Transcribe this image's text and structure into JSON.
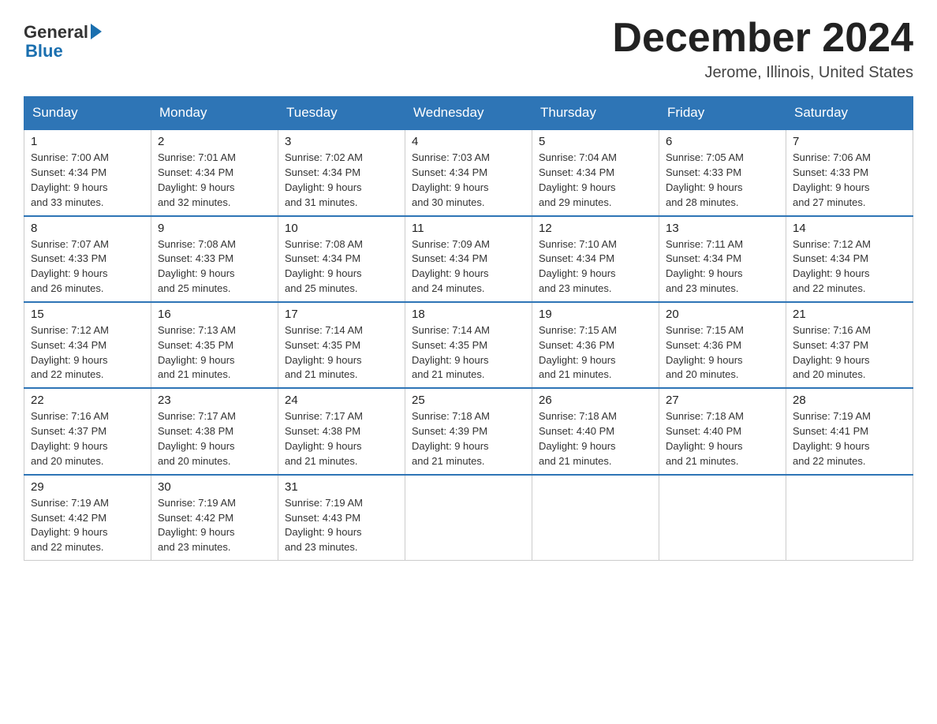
{
  "logo": {
    "text_general": "General",
    "text_blue": "Blue"
  },
  "title": "December 2024",
  "location": "Jerome, Illinois, United States",
  "weekdays": [
    "Sunday",
    "Monday",
    "Tuesday",
    "Wednesday",
    "Thursday",
    "Friday",
    "Saturday"
  ],
  "weeks": [
    [
      {
        "day": "1",
        "sunrise": "7:00 AM",
        "sunset": "4:34 PM",
        "daylight": "9 hours and 33 minutes."
      },
      {
        "day": "2",
        "sunrise": "7:01 AM",
        "sunset": "4:34 PM",
        "daylight": "9 hours and 32 minutes."
      },
      {
        "day": "3",
        "sunrise": "7:02 AM",
        "sunset": "4:34 PM",
        "daylight": "9 hours and 31 minutes."
      },
      {
        "day": "4",
        "sunrise": "7:03 AM",
        "sunset": "4:34 PM",
        "daylight": "9 hours and 30 minutes."
      },
      {
        "day": "5",
        "sunrise": "7:04 AM",
        "sunset": "4:34 PM",
        "daylight": "9 hours and 29 minutes."
      },
      {
        "day": "6",
        "sunrise": "7:05 AM",
        "sunset": "4:33 PM",
        "daylight": "9 hours and 28 minutes."
      },
      {
        "day": "7",
        "sunrise": "7:06 AM",
        "sunset": "4:33 PM",
        "daylight": "9 hours and 27 minutes."
      }
    ],
    [
      {
        "day": "8",
        "sunrise": "7:07 AM",
        "sunset": "4:33 PM",
        "daylight": "9 hours and 26 minutes."
      },
      {
        "day": "9",
        "sunrise": "7:08 AM",
        "sunset": "4:33 PM",
        "daylight": "9 hours and 25 minutes."
      },
      {
        "day": "10",
        "sunrise": "7:08 AM",
        "sunset": "4:34 PM",
        "daylight": "9 hours and 25 minutes."
      },
      {
        "day": "11",
        "sunrise": "7:09 AM",
        "sunset": "4:34 PM",
        "daylight": "9 hours and 24 minutes."
      },
      {
        "day": "12",
        "sunrise": "7:10 AM",
        "sunset": "4:34 PM",
        "daylight": "9 hours and 23 minutes."
      },
      {
        "day": "13",
        "sunrise": "7:11 AM",
        "sunset": "4:34 PM",
        "daylight": "9 hours and 23 minutes."
      },
      {
        "day": "14",
        "sunrise": "7:12 AM",
        "sunset": "4:34 PM",
        "daylight": "9 hours and 22 minutes."
      }
    ],
    [
      {
        "day": "15",
        "sunrise": "7:12 AM",
        "sunset": "4:34 PM",
        "daylight": "9 hours and 22 minutes."
      },
      {
        "day": "16",
        "sunrise": "7:13 AM",
        "sunset": "4:35 PM",
        "daylight": "9 hours and 21 minutes."
      },
      {
        "day": "17",
        "sunrise": "7:14 AM",
        "sunset": "4:35 PM",
        "daylight": "9 hours and 21 minutes."
      },
      {
        "day": "18",
        "sunrise": "7:14 AM",
        "sunset": "4:35 PM",
        "daylight": "9 hours and 21 minutes."
      },
      {
        "day": "19",
        "sunrise": "7:15 AM",
        "sunset": "4:36 PM",
        "daylight": "9 hours and 21 minutes."
      },
      {
        "day": "20",
        "sunrise": "7:15 AM",
        "sunset": "4:36 PM",
        "daylight": "9 hours and 20 minutes."
      },
      {
        "day": "21",
        "sunrise": "7:16 AM",
        "sunset": "4:37 PM",
        "daylight": "9 hours and 20 minutes."
      }
    ],
    [
      {
        "day": "22",
        "sunrise": "7:16 AM",
        "sunset": "4:37 PM",
        "daylight": "9 hours and 20 minutes."
      },
      {
        "day": "23",
        "sunrise": "7:17 AM",
        "sunset": "4:38 PM",
        "daylight": "9 hours and 20 minutes."
      },
      {
        "day": "24",
        "sunrise": "7:17 AM",
        "sunset": "4:38 PM",
        "daylight": "9 hours and 21 minutes."
      },
      {
        "day": "25",
        "sunrise": "7:18 AM",
        "sunset": "4:39 PM",
        "daylight": "9 hours and 21 minutes."
      },
      {
        "day": "26",
        "sunrise": "7:18 AM",
        "sunset": "4:40 PM",
        "daylight": "9 hours and 21 minutes."
      },
      {
        "day": "27",
        "sunrise": "7:18 AM",
        "sunset": "4:40 PM",
        "daylight": "9 hours and 21 minutes."
      },
      {
        "day": "28",
        "sunrise": "7:19 AM",
        "sunset": "4:41 PM",
        "daylight": "9 hours and 22 minutes."
      }
    ],
    [
      {
        "day": "29",
        "sunrise": "7:19 AM",
        "sunset": "4:42 PM",
        "daylight": "9 hours and 22 minutes."
      },
      {
        "day": "30",
        "sunrise": "7:19 AM",
        "sunset": "4:42 PM",
        "daylight": "9 hours and 23 minutes."
      },
      {
        "day": "31",
        "sunrise": "7:19 AM",
        "sunset": "4:43 PM",
        "daylight": "9 hours and 23 minutes."
      },
      null,
      null,
      null,
      null
    ]
  ]
}
